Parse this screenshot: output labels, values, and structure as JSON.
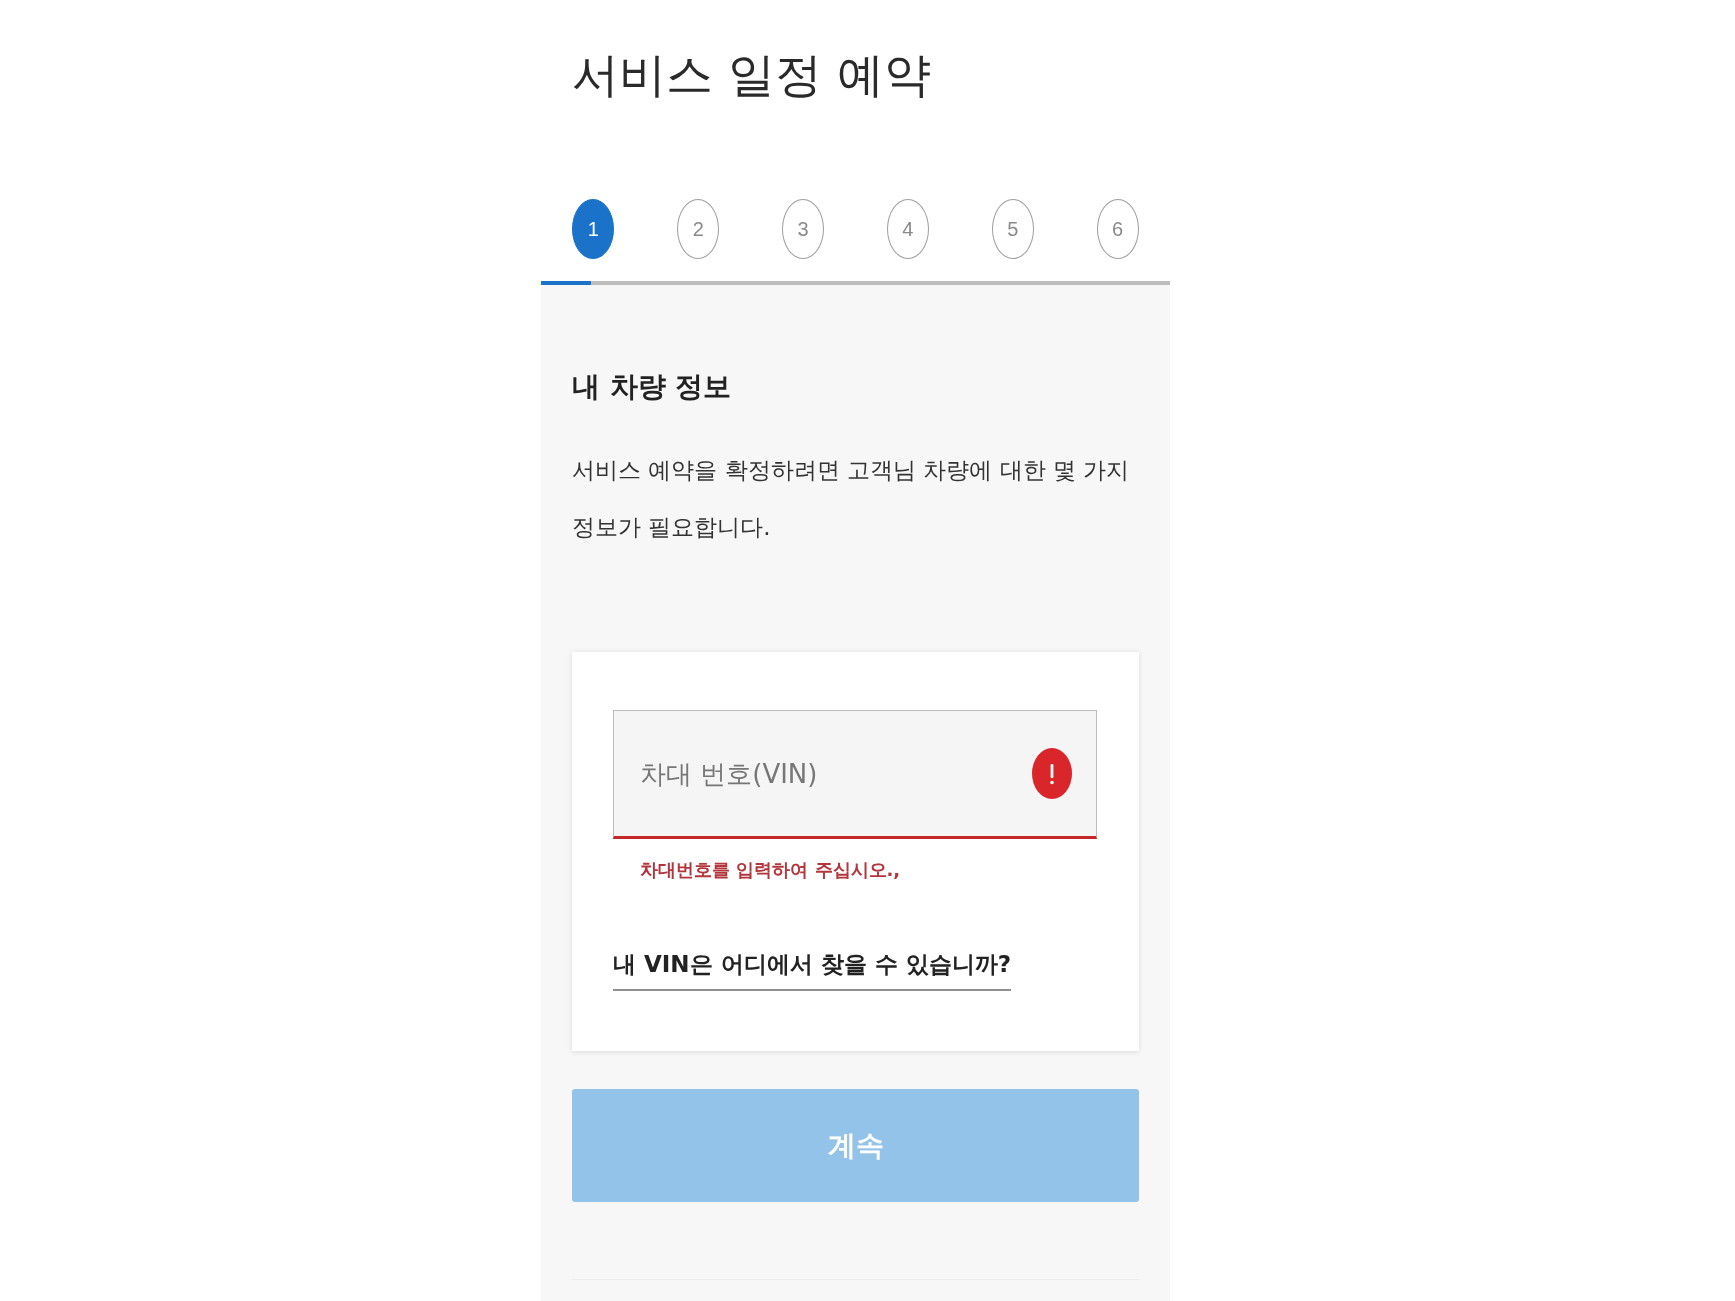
{
  "page": {
    "title": "서비스 일정 예약"
  },
  "stepper": {
    "steps": [
      {
        "label": "1",
        "selected": true
      },
      {
        "label": "2",
        "selected": false
      },
      {
        "label": "3",
        "selected": false
      },
      {
        "label": "4",
        "selected": false
      },
      {
        "label": "5",
        "selected": false
      },
      {
        "label": "6",
        "selected": false
      }
    ],
    "progress": {
      "level": 0.08
    }
  },
  "section": {
    "heading": "내 차량 정보",
    "description": "서비스 예약을 확정하려면 고객님 차량에 대한 몇 가지 정보가 필요합니다."
  },
  "vin_form": {
    "field": {
      "placeholder": "차대 번호(VIN)",
      "invalid": true
    },
    "error_message": "차대번호를 입력하여 주십시오.,",
    "help_link": "내 VIN은 어디에서 찾을 수 있습니까?"
  },
  "continue_button": {
    "label": "계속",
    "disabled": true
  }
}
